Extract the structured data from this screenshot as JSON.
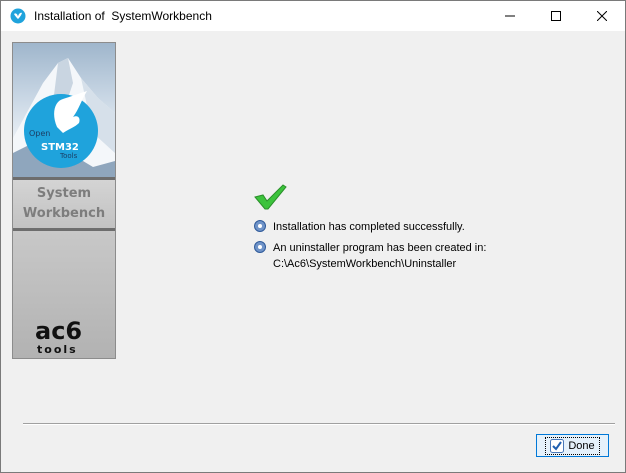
{
  "window": {
    "title": "Installation of  SystemWorkbench"
  },
  "sidebar": {
    "logo_open": "Open",
    "logo_stm32": "STM32",
    "logo_tools": "Tools",
    "product_line1": "System",
    "product_line2": "Workbench",
    "brand": "ac6",
    "brand_sub": "tools"
  },
  "messages": {
    "completed": "Installation has completed successfully.",
    "uninstaller": "An uninstaller program has been created in:",
    "uninstaller_path": "C:\\Ac6\\SystemWorkbench\\Uninstaller"
  },
  "footer": {
    "done_label": "Done"
  },
  "colors": {
    "accent": "#0078d7",
    "check_green": "#3cc33c",
    "logo_blue": "#1fa3dc"
  }
}
